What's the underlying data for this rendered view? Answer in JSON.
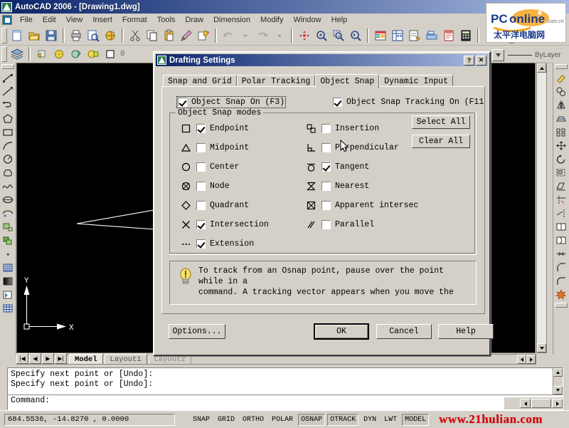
{
  "window": {
    "title": "AutoCAD 2006 - [Drawing1.dwg]",
    "icon": "autocad-icon"
  },
  "menubar": {
    "items": [
      {
        "label": "File"
      },
      {
        "label": "Edit"
      },
      {
        "label": "View"
      },
      {
        "label": "Insert"
      },
      {
        "label": "Format"
      },
      {
        "label": "Tools"
      },
      {
        "label": "Draw"
      },
      {
        "label": "Dimension"
      },
      {
        "label": "Modify"
      },
      {
        "label": "Window"
      },
      {
        "label": "Help"
      }
    ]
  },
  "standard_toolbar": {
    "buttons": [
      "new-icon",
      "open-icon",
      "save-icon",
      "print-icon",
      "print-preview-icon",
      "publish-icon",
      "cut-icon",
      "copy-icon",
      "paste-icon",
      "match-properties-icon",
      "undo-icon",
      "redo-icon",
      "pan-realtime-icon",
      "zoom-realtime-icon",
      "zoom-window-icon",
      "zoom-previous-icon",
      "properties-icon",
      "designcenter-icon",
      "tool-palettes-icon",
      "sheet-set-icon",
      "markup-set-icon",
      "calculator-icon",
      "help-icon",
      "text-style-icon"
    ]
  },
  "layer_toolbar": {
    "layer_name": "0",
    "linetype_value": "ByLayer",
    "buttons": [
      "layer-manager-icon",
      "layer-on-icon",
      "layer-freeze-icon",
      "layer-lock-icon",
      "layer-color-icon"
    ]
  },
  "draw_toolbar": {
    "buttons": [
      "line-icon",
      "construction-line-icon",
      "polyline-icon",
      "polygon-icon",
      "rectangle-icon",
      "arc-icon",
      "circle-icon",
      "revision-cloud-icon",
      "spline-icon",
      "ellipse-icon",
      "ellipse-arc-icon",
      "insert-block-icon",
      "make-block-icon",
      "point-icon",
      "hatch-icon",
      "gradient-icon",
      "region-icon",
      "table-icon",
      "multiline-text-icon"
    ]
  },
  "modify_toolbar": {
    "buttons": [
      "erase-icon",
      "copy-object-icon",
      "mirror-icon",
      "offset-icon",
      "array-icon",
      "move-icon",
      "rotate-icon",
      "scale-icon",
      "stretch-icon",
      "trim-icon",
      "extend-icon",
      "break-at-point-icon",
      "break-icon",
      "join-icon",
      "chamfer-icon",
      "fillet-icon",
      "explode-icon"
    ]
  },
  "canvas": {
    "ucs": {
      "x_label": "X",
      "y_label": "Y"
    }
  },
  "sheet_tabs": {
    "nav": [
      "first-icon",
      "prev-icon",
      "next-icon",
      "last-icon"
    ],
    "tabs": [
      {
        "label": "Model",
        "active": true
      },
      {
        "label": "Layout1",
        "active": false
      },
      {
        "label": "Layout2",
        "active": false
      }
    ]
  },
  "command_window": {
    "history": [
      "Specify next point or [Undo]:",
      "Specify next point or [Undo]:"
    ],
    "prompt": "Command:"
  },
  "statusbar": {
    "coordinates": "684.5536,  -14.8270 , 0.0000",
    "toggles": [
      {
        "label": "SNAP",
        "pressed": false
      },
      {
        "label": "GRID",
        "pressed": false
      },
      {
        "label": "ORTHO",
        "pressed": false
      },
      {
        "label": "POLAR",
        "pressed": false
      },
      {
        "label": "OSNAP",
        "pressed": true
      },
      {
        "label": "OTRACK",
        "pressed": true
      },
      {
        "label": "DYN",
        "pressed": false
      },
      {
        "label": "LWT",
        "pressed": false
      },
      {
        "label": "MODEL",
        "pressed": true
      }
    ],
    "watermark": "www.21hulian.com"
  },
  "logo": {
    "brand": "PConline",
    "suffix": ".com.cn",
    "subtitle": "太平洋电脑网"
  },
  "dialog": {
    "title": "Drafting Settings",
    "icon": "drafting-settings-icon",
    "title_buttons": [
      {
        "label": "?",
        "name": "help-button"
      },
      {
        "label": "✕",
        "name": "close-button"
      }
    ],
    "tabs": [
      {
        "label": "Snap and Grid",
        "active": false
      },
      {
        "label": "Polar Tracking",
        "active": false
      },
      {
        "label": "Object Snap",
        "active": true
      },
      {
        "label": "Dynamic Input",
        "active": false
      }
    ],
    "object_snap_on": {
      "label": "Object Snap On  (F3)",
      "checked": true
    },
    "object_snap_tracking_on": {
      "label": "Object Snap Tracking On  (F11",
      "checked": true
    },
    "group_title": "Object Snap modes",
    "modes_left": [
      {
        "label": "Endpoint",
        "checked": true,
        "glyph": "square-glyph"
      },
      {
        "label": "Midpoint",
        "checked": false,
        "glyph": "triangle-glyph"
      },
      {
        "label": "Center",
        "checked": false,
        "glyph": "circle-glyph"
      },
      {
        "label": "Node",
        "checked": false,
        "glyph": "node-glyph"
      },
      {
        "label": "Quadrant",
        "checked": false,
        "glyph": "diamond-glyph"
      },
      {
        "label": "Intersection",
        "checked": true,
        "glyph": "cross-glyph"
      },
      {
        "label": "Extension",
        "checked": true,
        "glyph": "dashes-glyph"
      }
    ],
    "modes_right": [
      {
        "label": "Insertion",
        "checked": false,
        "glyph": "insertion-glyph"
      },
      {
        "label": "Perpendicular",
        "checked": false,
        "glyph": "perpendicular-glyph"
      },
      {
        "label": "Tangent",
        "checked": true,
        "glyph": "tangent-glyph"
      },
      {
        "label": "Nearest",
        "checked": false,
        "glyph": "hourglass-glyph"
      },
      {
        "label": "Apparent intersec",
        "checked": false,
        "glyph": "boxed-cross-glyph"
      },
      {
        "label": "Parallel",
        "checked": false,
        "glyph": "parallel-glyph"
      }
    ],
    "select_all_label": "Select All",
    "clear_all_label": "Clear All",
    "tip_icon": "lightbulb-icon",
    "tip_line1": "To track from an Osnap point, pause over the point while in a",
    "tip_line2": "command.  A tracking vector appears when you move the",
    "options_label": "Options...",
    "ok_label": "OK",
    "cancel_label": "Cancel",
    "help_label": "Help"
  }
}
